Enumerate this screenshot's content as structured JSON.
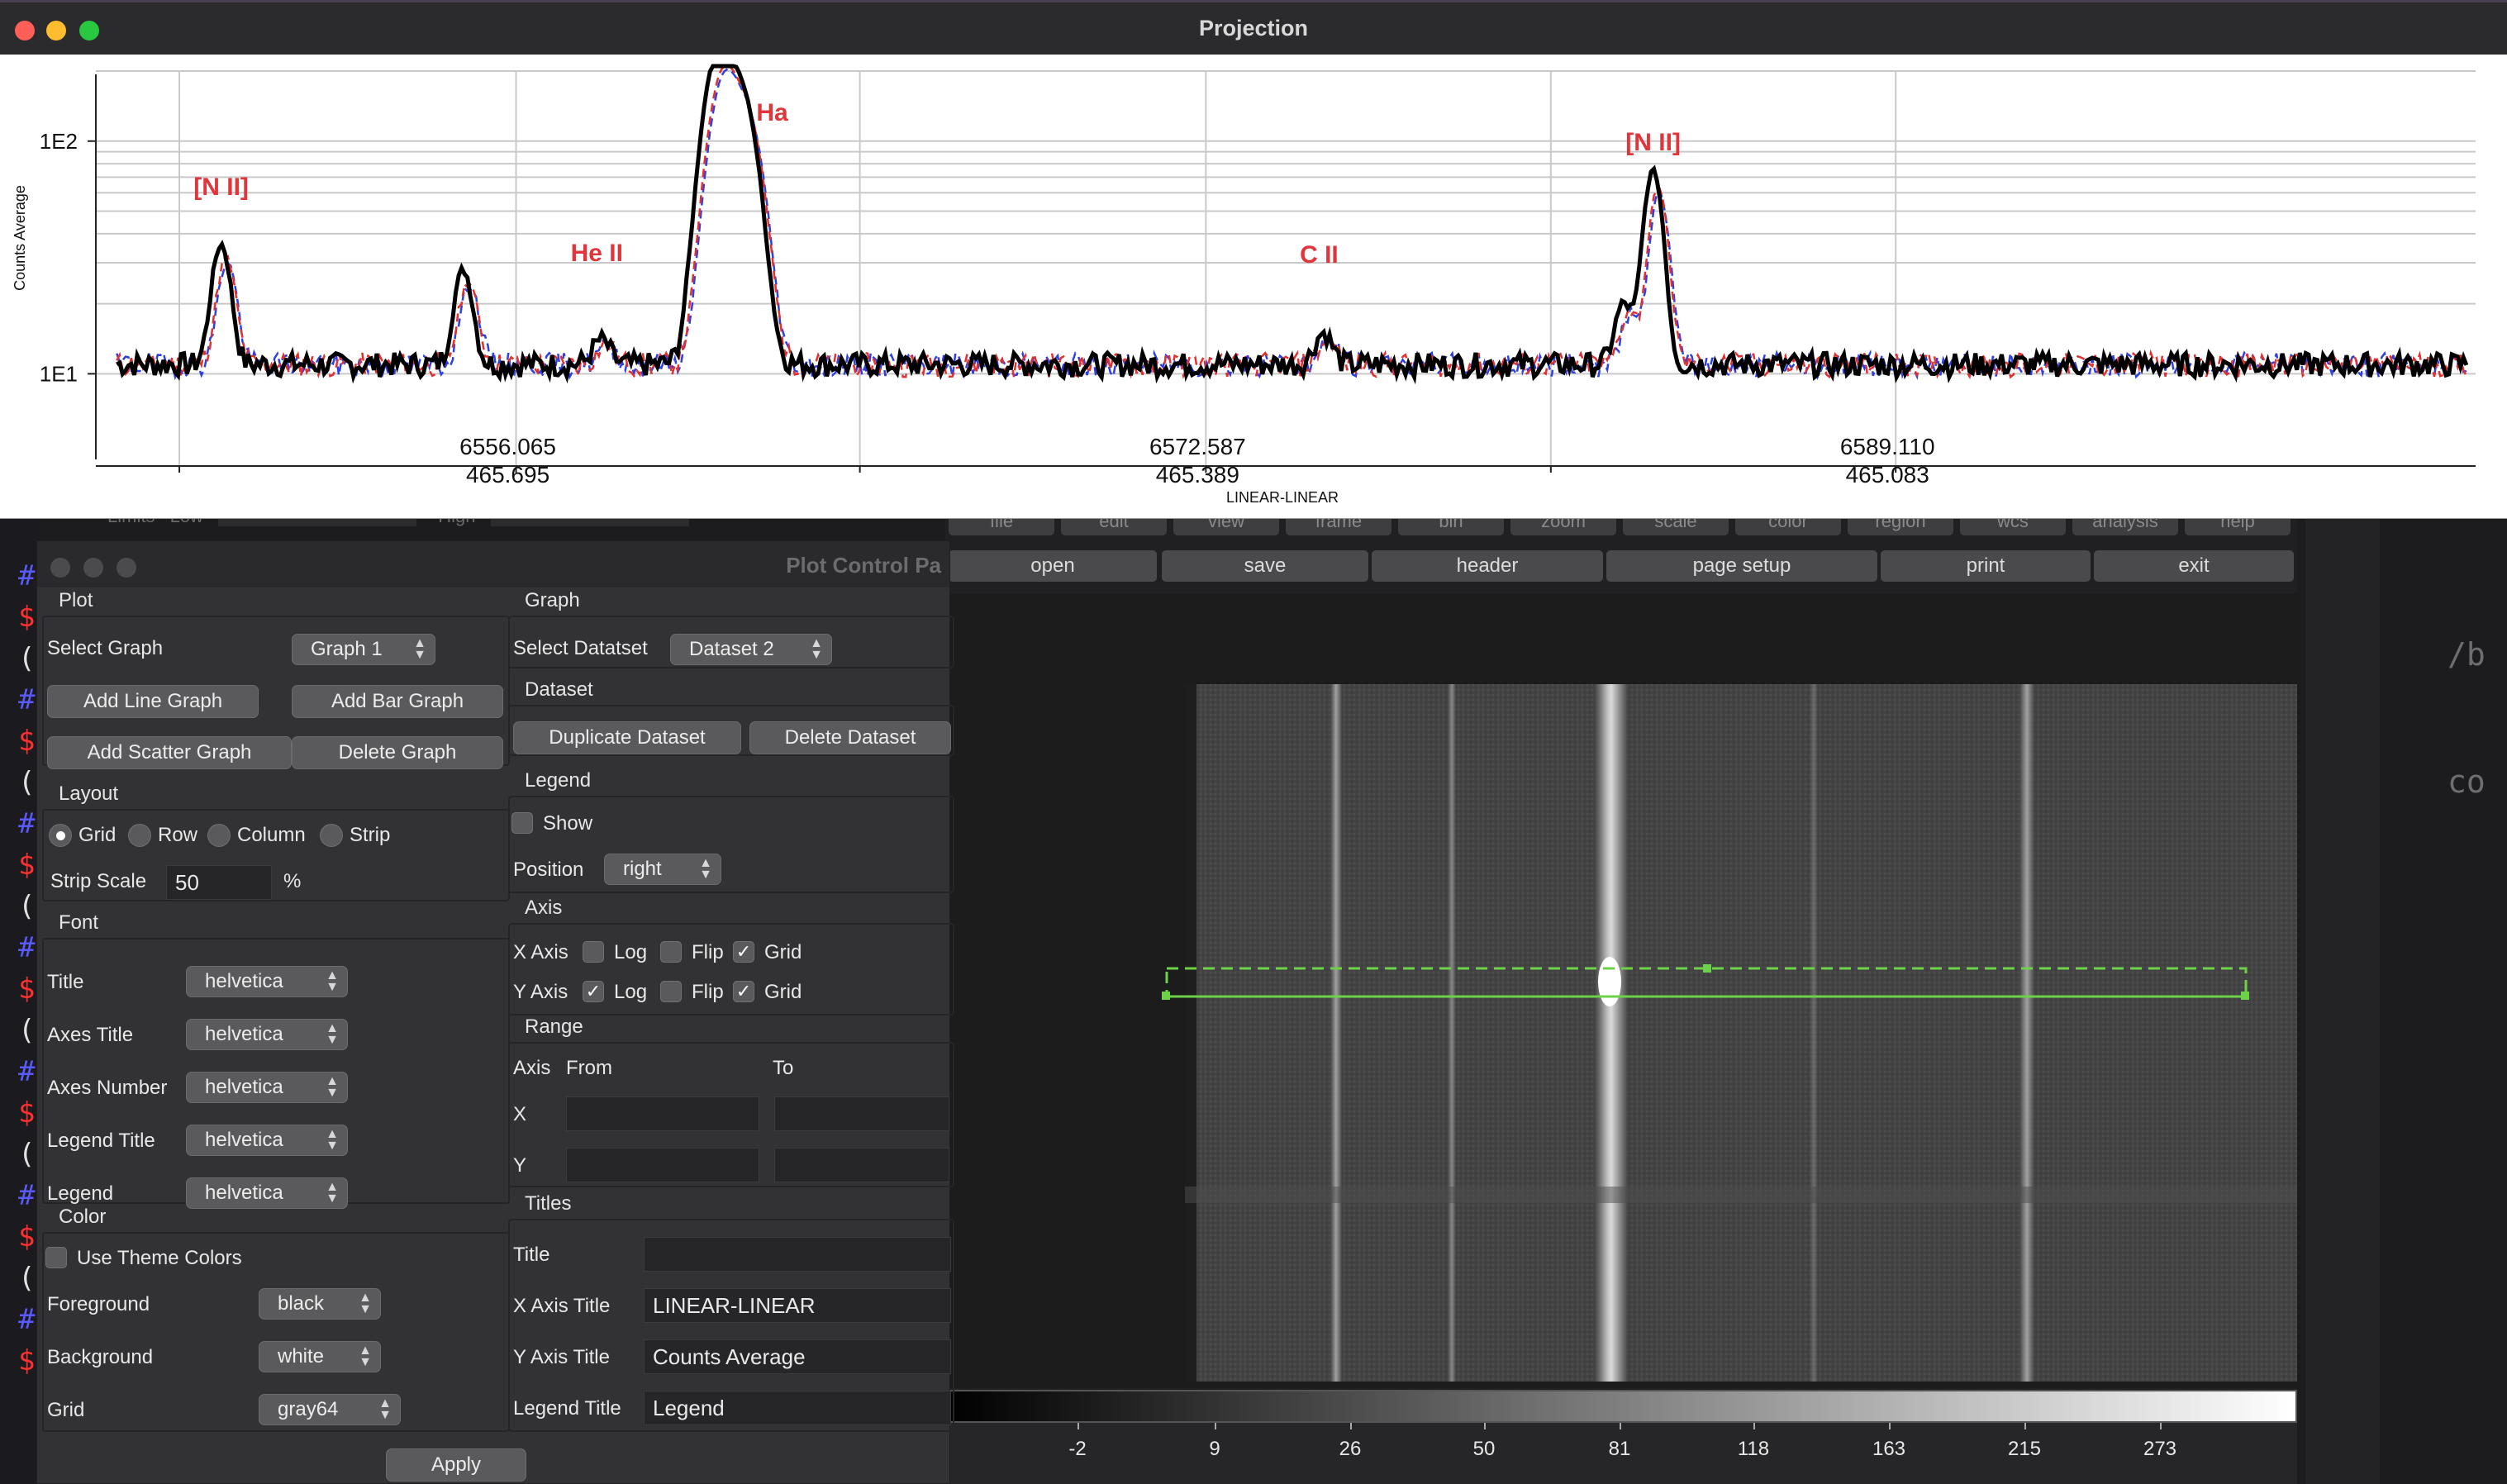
{
  "projection": {
    "title": "Projection",
    "chart_data": {
      "type": "line",
      "xlabel": "LINEAR-LINEAR",
      "ylabel": "Counts Average",
      "yscale": "log",
      "grid": true,
      "x_ticks": [
        {
          "top": "6556.065",
          "bottom": "465.695"
        },
        {
          "top": "6572.587",
          "bottom": "465.389"
        },
        {
          "top": "6589.110",
          "bottom": "465.083"
        }
      ],
      "y_ticks": [
        "1E1",
        "1E2"
      ],
      "annotations": [
        "[N II]",
        "He II",
        "Ha",
        "C II",
        "[N II]"
      ],
      "series": [
        {
          "color": "#000000",
          "style": "solid"
        },
        {
          "color": "#e03030",
          "style": "dashed"
        },
        {
          "color": "#3040e0",
          "style": "dashed"
        }
      ],
      "x_range": [
        6546,
        6603
      ],
      "y_range": [
        7,
        200
      ],
      "baseline": 11,
      "peaks": [
        {
          "x": 6549.0,
          "y": 36
        },
        {
          "x": 6554.8,
          "y": 28
        },
        {
          "x": 6558.1,
          "y": 14
        },
        {
          "x": 6560.9,
          "y": 230
        },
        {
          "x": 6561.5,
          "y": 140
        },
        {
          "x": 6575.4,
          "y": 15
        },
        {
          "x": 6583.3,
          "y": 75
        },
        {
          "x": 6582.6,
          "y": 20
        }
      ]
    }
  },
  "control_panel": {
    "title": "Plot Control Pa",
    "plot": {
      "header": "Plot",
      "select_graph_label": "Select Graph",
      "select_graph_value": "Graph 1",
      "add_line": "Add Line Graph",
      "add_bar": "Add Bar Graph",
      "add_scatter": "Add Scatter Graph",
      "delete_graph": "Delete Graph"
    },
    "layout": {
      "header": "Layout",
      "options": [
        "Grid",
        "Row",
        "Column",
        "Strip"
      ],
      "selected": "Grid",
      "strip_scale_label": "Strip Scale",
      "strip_scale_value": "50",
      "strip_scale_unit": "%"
    },
    "font": {
      "header": "Font",
      "rows": [
        {
          "label": "Title",
          "value": "helvetica"
        },
        {
          "label": "Axes Title",
          "value": "helvetica"
        },
        {
          "label": "Axes Number",
          "value": "helvetica"
        },
        {
          "label": "Legend Title",
          "value": "helvetica"
        },
        {
          "label": "Legend",
          "value": "helvetica"
        }
      ]
    },
    "color": {
      "header": "Color",
      "use_theme": "Use Theme Colors",
      "rows": [
        {
          "label": "Foreground",
          "value": "black"
        },
        {
          "label": "Background",
          "value": "white"
        },
        {
          "label": "Grid",
          "value": "gray64"
        }
      ]
    },
    "graph": {
      "header": "Graph",
      "select_dataset_label": "Select Datatset",
      "select_dataset_value": "Dataset 2",
      "dataset_header": "Dataset",
      "duplicate": "Duplicate Dataset",
      "delete": "Delete Dataset",
      "legend_header": "Legend",
      "show": "Show",
      "position_label": "Position",
      "position_value": "right",
      "axis_header": "Axis",
      "x_axis": "X Axis",
      "y_axis": "Y Axis",
      "log": "Log",
      "flip": "Flip",
      "grid": "Grid",
      "range_header": "Range",
      "range_axis": "Axis",
      "range_from": "From",
      "range_to": "To",
      "range_x": "X",
      "range_y": "Y",
      "titles_header": "Titles",
      "title_label": "Title",
      "title_value": "",
      "xaxis_title_label": "X Axis Title",
      "xaxis_title_value": "LINEAR-LINEAR",
      "yaxis_title_label": "Y Axis Title",
      "yaxis_title_value": "Counts Average",
      "legend_title_label": "Legend Title",
      "legend_title_value": "Legend"
    },
    "apply": "Apply"
  },
  "ds9": {
    "menu_hidden": [
      "file",
      "edit",
      "view",
      "frame",
      "bin",
      "zoom",
      "scale",
      "color",
      "region",
      "wcs",
      "analysis",
      "help"
    ],
    "buttons": [
      "open",
      "save",
      "header",
      "page setup",
      "print",
      "exit"
    ],
    "limits_label": "Limits",
    "limits_low_label": "Low",
    "limits_high_label": "High",
    "colorbar_ticks": [
      "-2",
      "9",
      "26",
      "50",
      "81",
      "118",
      "163",
      "215",
      "273"
    ]
  },
  "terminal": {
    "glyphs": [
      "#",
      "$",
      "(",
      "#",
      "$",
      "(",
      "#",
      "$",
      "(",
      "#",
      "$",
      "(",
      "#",
      "$",
      "(",
      "#",
      "$",
      "(",
      "#",
      "$"
    ],
    "right_text": [
      "/b",
      "co"
    ]
  }
}
